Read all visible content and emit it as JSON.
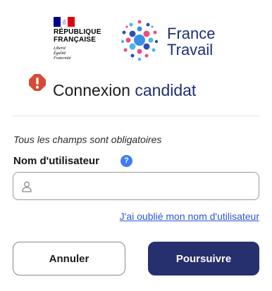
{
  "header": {
    "rf_logo": {
      "name": "RÉPUBLIQUE\nFRANÇAISE",
      "motto": "Liberté\nÉgalité\nFraternité"
    },
    "brand_logo": {
      "name": "France\nTravail",
      "color": "#1f2f76"
    }
  },
  "title": {
    "icon": "alert-icon",
    "text_plain": "Connexion ",
    "text_accent": "candidat"
  },
  "form": {
    "required_note": "Tous les champs sont obligatoires",
    "username_label": "Nom d'utilisateur",
    "help_icon_glyph": "?",
    "username_value": "",
    "username_placeholder": "",
    "forgot_link": "J'ai oublié mon nom d'utilisateur"
  },
  "actions": {
    "cancel_label": "Annuler",
    "continue_label": "Poursuivre",
    "primary_color": "#26306e"
  }
}
